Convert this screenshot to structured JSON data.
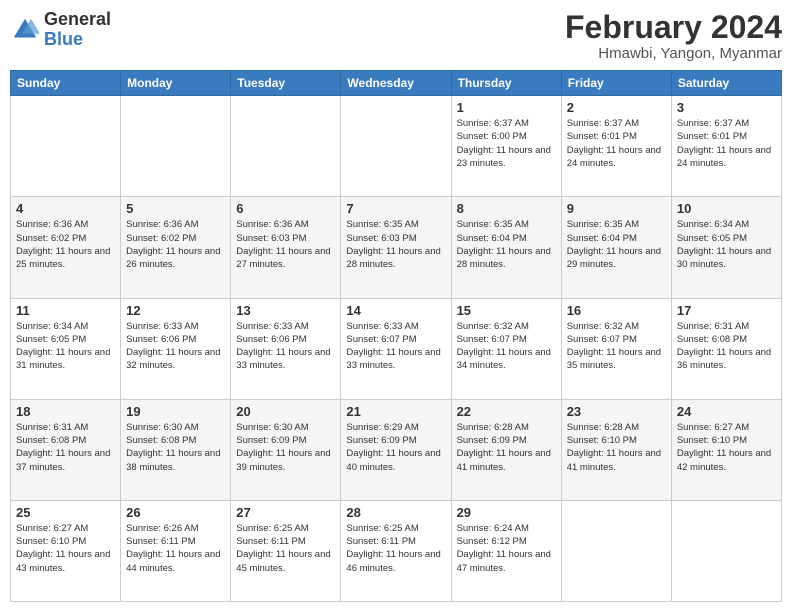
{
  "logo": {
    "general": "General",
    "blue": "Blue"
  },
  "header": {
    "title": "February 2024",
    "subtitle": "Hmawbi, Yangon, Myanmar"
  },
  "days_of_week": [
    "Sunday",
    "Monday",
    "Tuesday",
    "Wednesday",
    "Thursday",
    "Friday",
    "Saturday"
  ],
  "weeks": [
    [
      {
        "day": "",
        "info": ""
      },
      {
        "day": "",
        "info": ""
      },
      {
        "day": "",
        "info": ""
      },
      {
        "day": "",
        "info": ""
      },
      {
        "day": "1",
        "info": "Sunrise: 6:37 AM\nSunset: 6:00 PM\nDaylight: 11 hours and 23 minutes."
      },
      {
        "day": "2",
        "info": "Sunrise: 6:37 AM\nSunset: 6:01 PM\nDaylight: 11 hours and 24 minutes."
      },
      {
        "day": "3",
        "info": "Sunrise: 6:37 AM\nSunset: 6:01 PM\nDaylight: 11 hours and 24 minutes."
      }
    ],
    [
      {
        "day": "4",
        "info": "Sunrise: 6:36 AM\nSunset: 6:02 PM\nDaylight: 11 hours and 25 minutes."
      },
      {
        "day": "5",
        "info": "Sunrise: 6:36 AM\nSunset: 6:02 PM\nDaylight: 11 hours and 26 minutes."
      },
      {
        "day": "6",
        "info": "Sunrise: 6:36 AM\nSunset: 6:03 PM\nDaylight: 11 hours and 27 minutes."
      },
      {
        "day": "7",
        "info": "Sunrise: 6:35 AM\nSunset: 6:03 PM\nDaylight: 11 hours and 28 minutes."
      },
      {
        "day": "8",
        "info": "Sunrise: 6:35 AM\nSunset: 6:04 PM\nDaylight: 11 hours and 28 minutes."
      },
      {
        "day": "9",
        "info": "Sunrise: 6:35 AM\nSunset: 6:04 PM\nDaylight: 11 hours and 29 minutes."
      },
      {
        "day": "10",
        "info": "Sunrise: 6:34 AM\nSunset: 6:05 PM\nDaylight: 11 hours and 30 minutes."
      }
    ],
    [
      {
        "day": "11",
        "info": "Sunrise: 6:34 AM\nSunset: 6:05 PM\nDaylight: 11 hours and 31 minutes."
      },
      {
        "day": "12",
        "info": "Sunrise: 6:33 AM\nSunset: 6:06 PM\nDaylight: 11 hours and 32 minutes."
      },
      {
        "day": "13",
        "info": "Sunrise: 6:33 AM\nSunset: 6:06 PM\nDaylight: 11 hours and 33 minutes."
      },
      {
        "day": "14",
        "info": "Sunrise: 6:33 AM\nSunset: 6:07 PM\nDaylight: 11 hours and 33 minutes."
      },
      {
        "day": "15",
        "info": "Sunrise: 6:32 AM\nSunset: 6:07 PM\nDaylight: 11 hours and 34 minutes."
      },
      {
        "day": "16",
        "info": "Sunrise: 6:32 AM\nSunset: 6:07 PM\nDaylight: 11 hours and 35 minutes."
      },
      {
        "day": "17",
        "info": "Sunrise: 6:31 AM\nSunset: 6:08 PM\nDaylight: 11 hours and 36 minutes."
      }
    ],
    [
      {
        "day": "18",
        "info": "Sunrise: 6:31 AM\nSunset: 6:08 PM\nDaylight: 11 hours and 37 minutes."
      },
      {
        "day": "19",
        "info": "Sunrise: 6:30 AM\nSunset: 6:08 PM\nDaylight: 11 hours and 38 minutes."
      },
      {
        "day": "20",
        "info": "Sunrise: 6:30 AM\nSunset: 6:09 PM\nDaylight: 11 hours and 39 minutes."
      },
      {
        "day": "21",
        "info": "Sunrise: 6:29 AM\nSunset: 6:09 PM\nDaylight: 11 hours and 40 minutes."
      },
      {
        "day": "22",
        "info": "Sunrise: 6:28 AM\nSunset: 6:09 PM\nDaylight: 11 hours and 41 minutes."
      },
      {
        "day": "23",
        "info": "Sunrise: 6:28 AM\nSunset: 6:10 PM\nDaylight: 11 hours and 41 minutes."
      },
      {
        "day": "24",
        "info": "Sunrise: 6:27 AM\nSunset: 6:10 PM\nDaylight: 11 hours and 42 minutes."
      }
    ],
    [
      {
        "day": "25",
        "info": "Sunrise: 6:27 AM\nSunset: 6:10 PM\nDaylight: 11 hours and 43 minutes."
      },
      {
        "day": "26",
        "info": "Sunrise: 6:26 AM\nSunset: 6:11 PM\nDaylight: 11 hours and 44 minutes."
      },
      {
        "day": "27",
        "info": "Sunrise: 6:25 AM\nSunset: 6:11 PM\nDaylight: 11 hours and 45 minutes."
      },
      {
        "day": "28",
        "info": "Sunrise: 6:25 AM\nSunset: 6:11 PM\nDaylight: 11 hours and 46 minutes."
      },
      {
        "day": "29",
        "info": "Sunrise: 6:24 AM\nSunset: 6:12 PM\nDaylight: 11 hours and 47 minutes."
      },
      {
        "day": "",
        "info": ""
      },
      {
        "day": "",
        "info": ""
      }
    ]
  ]
}
